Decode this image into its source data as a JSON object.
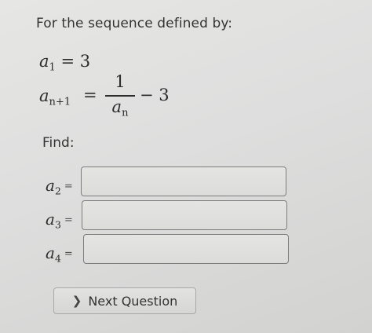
{
  "problem": {
    "prompt": "For the sequence defined by:",
    "initial": {
      "lhs_symbol": "a",
      "lhs_index": "1",
      "equals": "=",
      "value": "3"
    },
    "recurrence": {
      "lhs_symbol": "a",
      "lhs_index": "n+1",
      "equals": "=",
      "numerator": "1",
      "denominator_symbol": "a",
      "denominator_index": "n",
      "tail": "− 3"
    },
    "find_label": "Find:"
  },
  "answers": [
    {
      "symbol": "a",
      "index": "2",
      "equals": "=",
      "value": "",
      "placeholder": ""
    },
    {
      "symbol": "a",
      "index": "3",
      "equals": "=",
      "value": "",
      "placeholder": ""
    },
    {
      "symbol": "a",
      "index": "4",
      "equals": "=",
      "value": "",
      "placeholder": ""
    }
  ],
  "next_button": {
    "icon": "chevron-right-icon",
    "label": "Next Question"
  }
}
